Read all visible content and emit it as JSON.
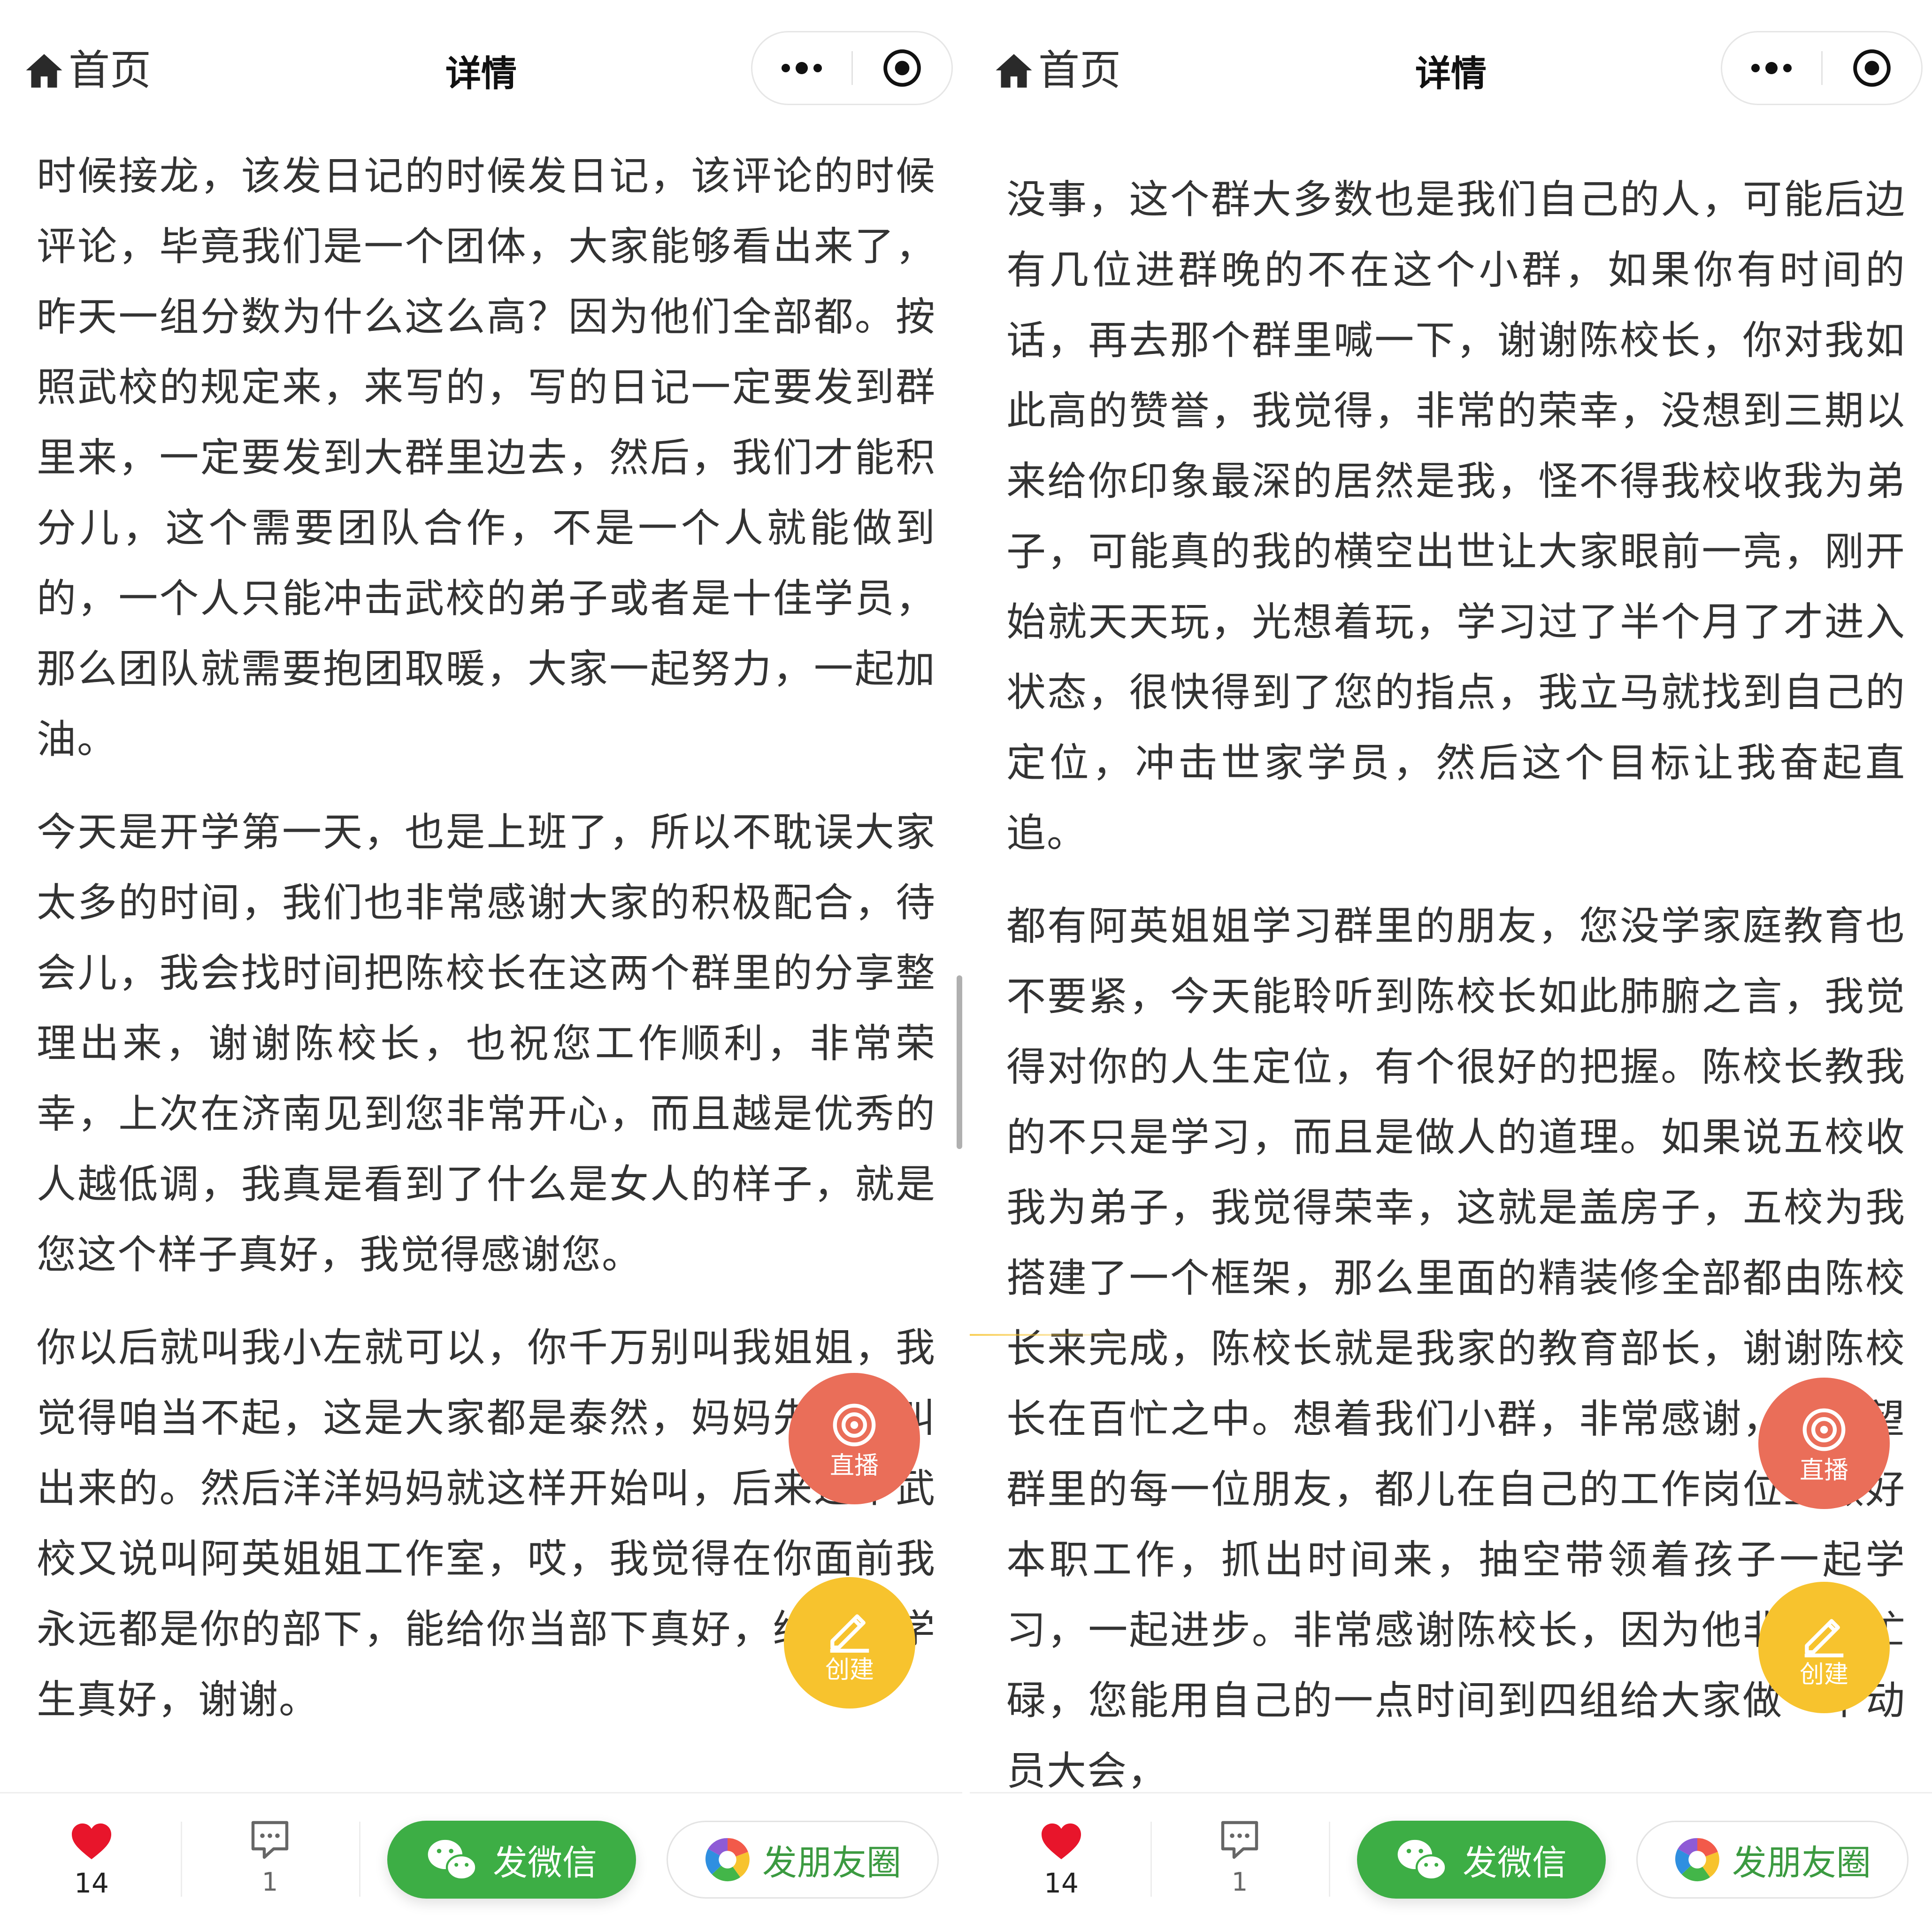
{
  "header": {
    "home_label": "首页",
    "title": "详情"
  },
  "left": {
    "paragraphs": [
      "时候接龙，该发日记的时候发日记，该评论的时候评论，毕竟我们是一个团体，大家能够看出来了，昨天一组分数为什么这么高？因为他们全部都。按照武校的规定来，来写的，写的日记一定要发到群里来，一定要发到大群里边去，然后，我们才能积分儿，这个需要团队合作，不是一个人就能做到的，一个人只能冲击武校的弟子或者是十佳学员，那么团队就需要抱团取暖，大家一起努力，一起加油。",
      "今天是开学第一天，也是上班了，所以不耽误大家太多的时间，我们也非常感谢大家的积极配合，待会儿，我会找时间把陈校长在这两个群里的分享整理出来，谢谢陈校长，也祝您工作顺利，非常荣幸，上次在济南见到您非常开心，而且越是优秀的人越低调，我真是看到了什么是女人的样子，就是您这个样子真好，我觉得感谢您。",
      "你以后就叫我小左就可以，你千万别叫我姐姐，我觉得咱当不起，这是大家都是泰然，妈妈先这样叫出来的。然后洋洋妈妈就这样开始叫，后来这个武校又说叫阿英姐姐工作室，哎，我觉得在你面前我永远都是你的部下，能给你当部下真好，给你当学生真好，谢谢。"
    ]
  },
  "right": {
    "paragraphs": [
      "没事，这个群大多数也是我们自己的人，可能后边有几位进群晚的不在这个小群，如果你有时间的话，再去那个群里喊一下，谢谢陈校长，你对我如此高的赞誉，我觉得，非常的荣幸，没想到三期以来给你印象最深的居然是我，怪不得我校收我为弟子，可能真的我的横空出世让大家眼前一亮，刚开始就天天玩，光想着玩，学习过了半个月了才进入状态，很快得到了您的指点，我立马就找到自己的定位，冲击世家学员，然后这个目标让我奋起直追。",
      "都有阿英姐姐学习群里的朋友，您没学家庭教育也不要紧，今天能聆听到陈校长如此肺腑之言，我觉得对你的人生定位，有个很好的把握。陈校长教我的不只是学习，而且是做人的道理。如果说五校收我为弟子，我觉得荣幸，这就是盖房子，五校为我搭建了一个框架，那么里面的精装修全部都由陈校长来完成，陈校长就是我家的教育部长，谢谢陈校长在百忙之中。想着我们小群，非常感谢，也希望群里的每一位朋友，都儿在自己的工作岗位上做好本职工作，抓出时间来，抽空带领着孩子一起学习，一起进步。非常感谢陈校长，因为他非常的忙碌，您能用自己的一点时间到四组给大家做一个动员大会，"
    ]
  },
  "fab": {
    "live_label": "直播",
    "create_label": "创建"
  },
  "bottom": {
    "like_count": "14",
    "comment_count": "1",
    "wechat_label": "发微信",
    "moments_label": "发朋友圈"
  },
  "colors": {
    "live": "#ea6e59",
    "create": "#f7c32e",
    "wechat_green": "#3dae45",
    "like_red": "#e8152b"
  },
  "icons": [
    "home-icon",
    "more-dots-icon",
    "target-icon",
    "live-icon",
    "pencil-icon",
    "heart-icon",
    "comment-icon",
    "wechat-icon",
    "moments-icon"
  ]
}
